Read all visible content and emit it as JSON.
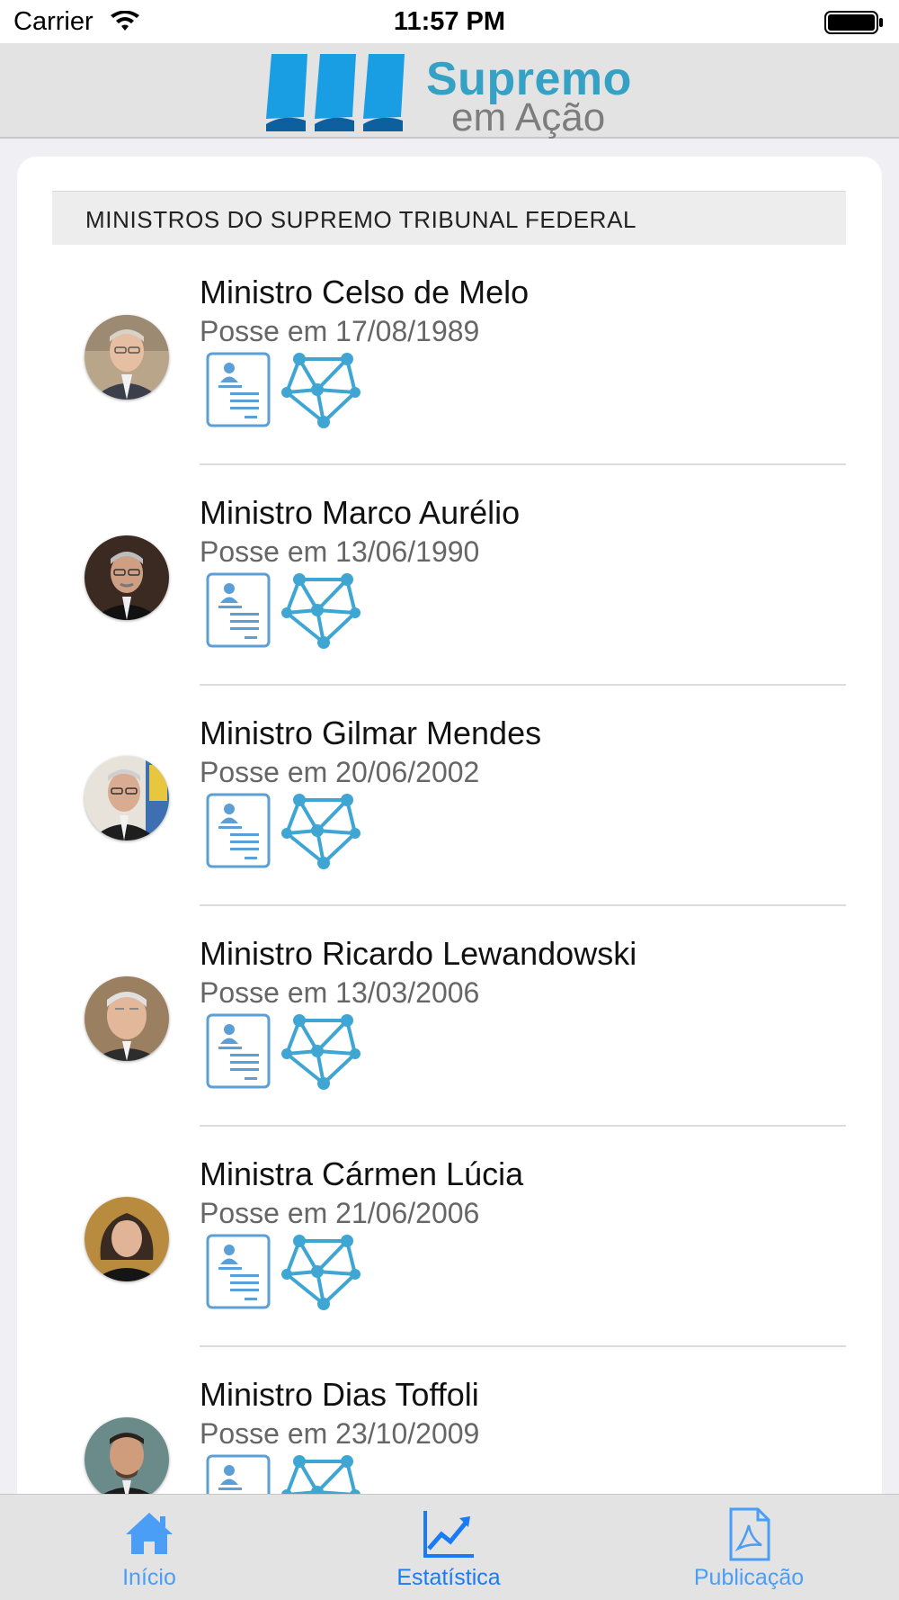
{
  "status_bar": {
    "carrier": "Carrier",
    "time": "11:57 PM"
  },
  "header": {
    "logo_line1": "Supremo",
    "logo_line2": "em Ação",
    "logo_color": "#35a1c4"
  },
  "section": {
    "title": "MINISTROS DO SUPREMO TRIBUNAL FEDERAL"
  },
  "ministers": [
    {
      "name": "Ministro Celso de Melo",
      "posse": "Posse em 17/08/1989"
    },
    {
      "name": "Ministro Marco Aurélio",
      "posse": "Posse em 13/06/1990"
    },
    {
      "name": "Ministro Gilmar Mendes",
      "posse": "Posse em 20/06/2002"
    },
    {
      "name": "Ministro Ricardo Lewandowski",
      "posse": "Posse em 13/03/2006"
    },
    {
      "name": "Ministra Cármen Lúcia",
      "posse": "Posse em 21/06/2006"
    },
    {
      "name": "Ministro Dias Toffoli",
      "posse": "Posse em 23/10/2009"
    }
  ],
  "tab_bar": {
    "tabs": [
      {
        "label": "Início",
        "icon": "home-icon"
      },
      {
        "label": "Estatística",
        "icon": "chart-trend-icon",
        "selected": true
      },
      {
        "label": "Publicação",
        "icon": "pdf-document-icon"
      }
    ],
    "active_color": "#1a7cf5",
    "inactive_color": "#4a9ef5"
  }
}
